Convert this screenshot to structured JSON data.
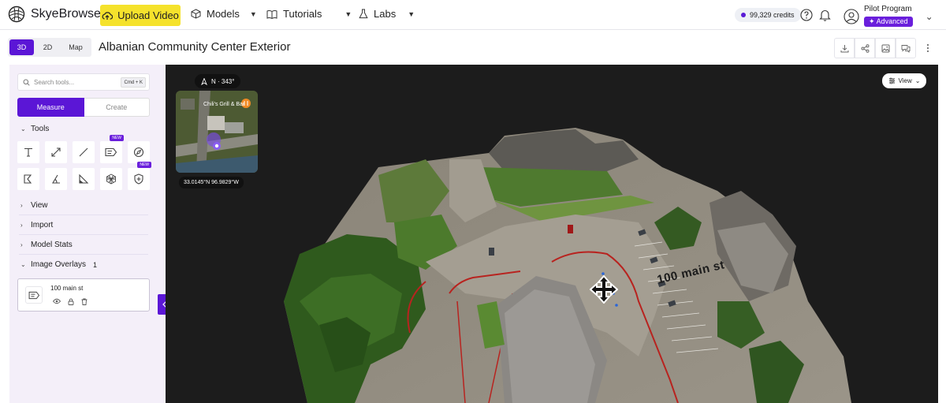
{
  "app": {
    "name": "SkyeBrowse",
    "upload_label": "Upload Video",
    "nav": [
      "Models",
      "Tutorials",
      "Labs"
    ],
    "credits": "99,329 credits",
    "user_name": "Pilot Program",
    "plan": "Advanced"
  },
  "toolbar": {
    "modes": [
      "3D",
      "2D",
      "Map"
    ],
    "active_mode": "3D",
    "title": "Albanian Community Center Exterior"
  },
  "sidebar": {
    "search_placeholder": "Search tools...",
    "shortcut": "Cmd + K",
    "tabs": [
      "Measure",
      "Create"
    ],
    "active_tab": "Measure",
    "sections": {
      "tools": "Tools",
      "view": "View",
      "import": "Import",
      "model_stats": "Model Stats",
      "image_overlays": "Image Overlays",
      "image_overlays_count": "1"
    },
    "badge_new": "NEW",
    "overlay_item": "100 main st"
  },
  "viewport": {
    "compass": "N · 343°",
    "minimap_place": "Chili's Grill & Bar",
    "coords": "33.0145°N 96.9829°W",
    "view_label": "View",
    "ground_label": "100 main st"
  },
  "colors": {
    "accent": "#5b16d6",
    "upload_yellow": "#f5e22c",
    "sidebar_bg": "#f4eff9",
    "viewport_bg": "#1c1c1c"
  },
  "icons": {
    "tools_row1": [
      "text-icon",
      "arrow-line-icon",
      "line-icon",
      "label-tag-icon",
      "compass-check-icon"
    ],
    "tools_row2": [
      "polygon-corner-icon",
      "angle-icon",
      "right-triangle-icon",
      "mesh-cube-icon",
      "shield-plus-icon"
    ]
  }
}
